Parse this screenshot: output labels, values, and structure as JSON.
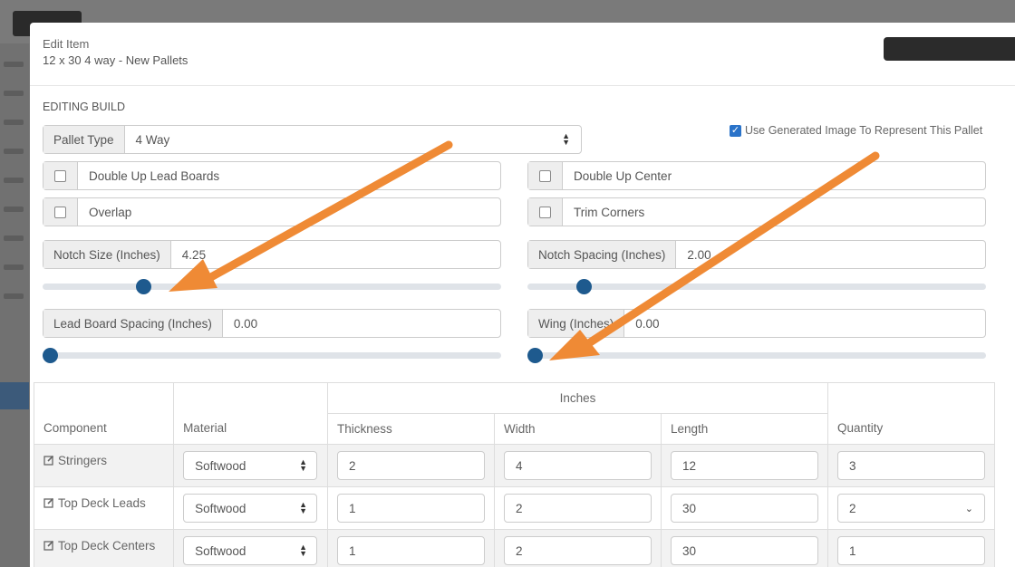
{
  "modal": {
    "title": "Edit Item",
    "subtitle": "12 x 30 4 way - New Pallets"
  },
  "editing": {
    "section_label": "EDITING BUILD",
    "use_generated_image_label": "Use Generated Image To Represent This Pallet",
    "use_generated_image_checked": true,
    "pallet_type": {
      "label": "Pallet Type",
      "value": "4 Way"
    },
    "double_up_lead_boards": "Double Up Lead Boards",
    "double_up_center": "Double Up Center",
    "overlap": "Overlap",
    "trim_corners": "Trim Corners",
    "notch_size": {
      "label": "Notch Size (Inches)",
      "value": "4.25",
      "slider_fraction": 0.21
    },
    "notch_spacing": {
      "label": "Notch Spacing (Inches)",
      "value": "2.00",
      "slider_fraction": 0.11
    },
    "lead_board_spacing": {
      "label": "Lead Board Spacing (Inches)",
      "value": "0.00",
      "slider_fraction": 0.0
    },
    "wing": {
      "label": "Wing (Inches)",
      "value": "0.00",
      "slider_fraction": 0.0
    }
  },
  "table": {
    "group_header": "Inches",
    "headers": {
      "component": "Component",
      "material": "Material",
      "thickness": "Thickness",
      "width": "Width",
      "length": "Length",
      "quantity": "Quantity"
    },
    "rows": [
      {
        "component": "Stringers",
        "material": "Softwood",
        "thickness": "2",
        "width": "4",
        "length": "12",
        "quantity": "3"
      },
      {
        "component": "Top Deck Leads",
        "material": "Softwood",
        "thickness": "1",
        "width": "2",
        "length": "30",
        "quantity": "2"
      },
      {
        "component": "Top Deck Centers",
        "material": "Softwood",
        "thickness": "1",
        "width": "2",
        "length": "30",
        "quantity": "1"
      }
    ]
  },
  "colors": {
    "accent": "#1e5a8e",
    "annotation_arrow": "#ef8a35",
    "checkbox_checked": "#2a73c9"
  }
}
